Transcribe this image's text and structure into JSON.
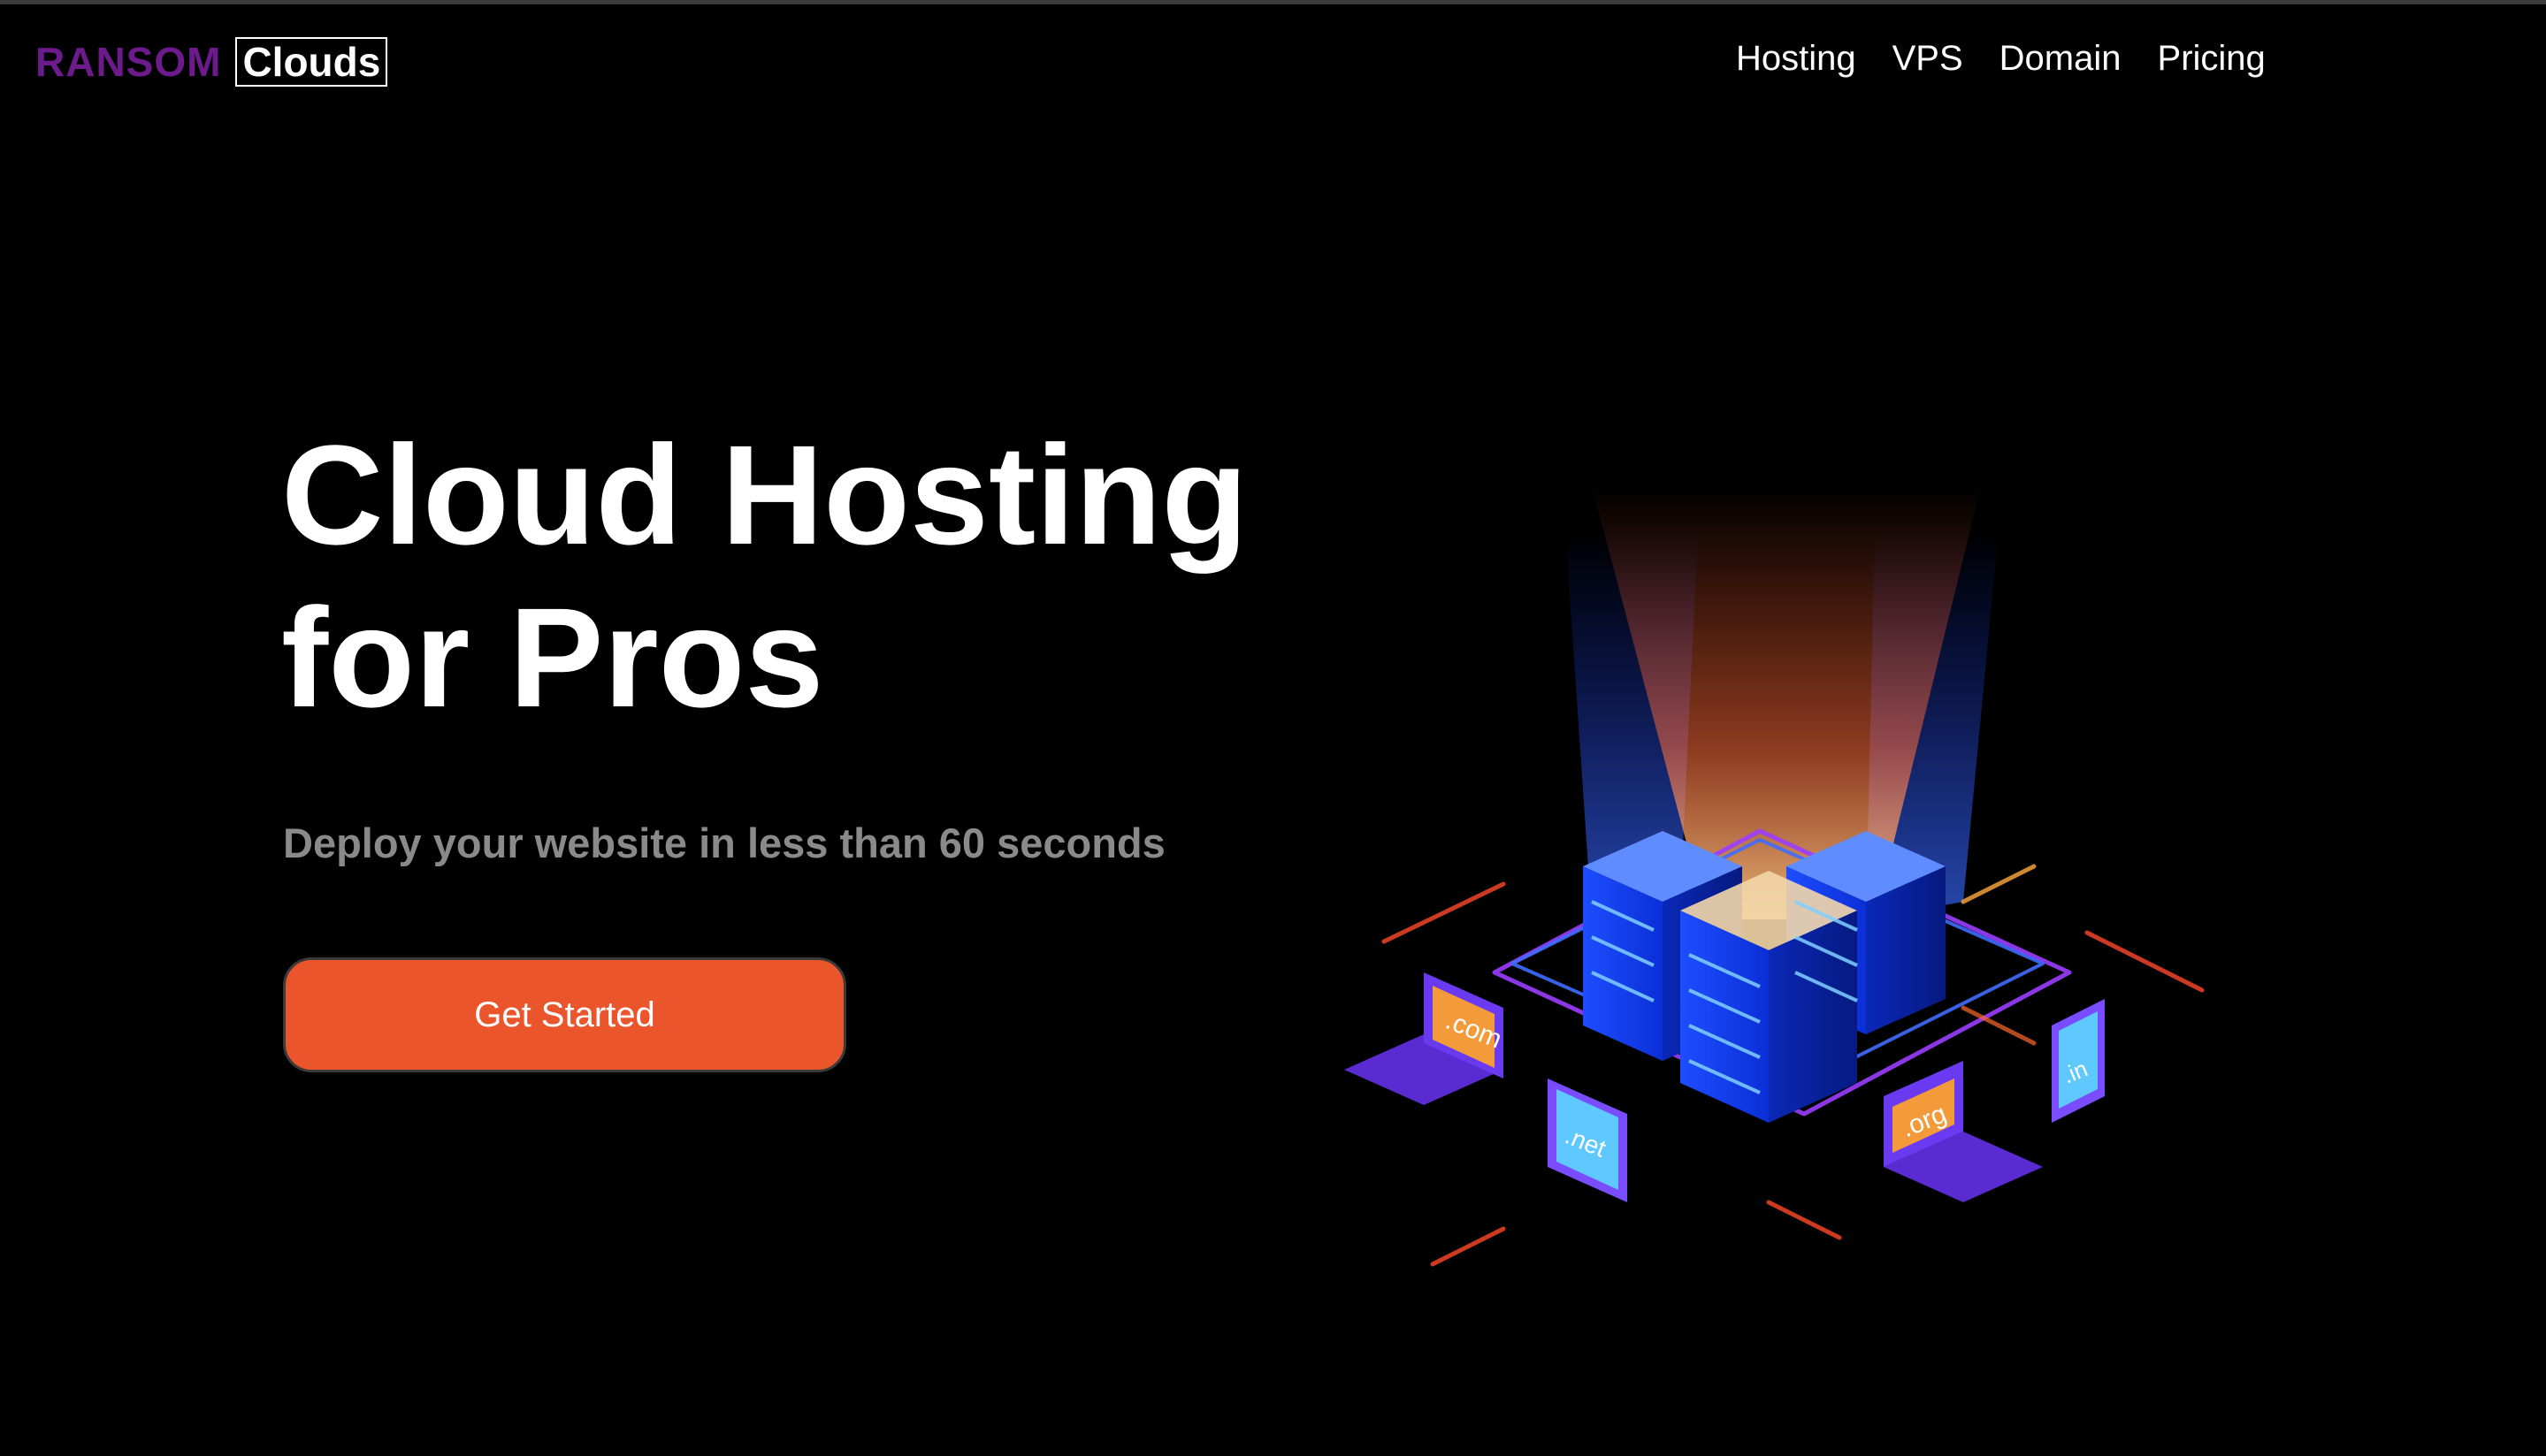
{
  "brand": {
    "part1": "RANSOM",
    "part2": "Clouds"
  },
  "nav": {
    "items": [
      "Hosting",
      "VPS",
      "Domain",
      "Pricing"
    ]
  },
  "hero": {
    "title_line1": "Cloud Hosting",
    "title_line2": "for Pros",
    "subtitle": "Deploy your website in less than 60 seconds",
    "cta_label": "Get Started"
  },
  "illustration": {
    "labels": [
      ".com",
      ".net",
      ".org",
      ".in"
    ]
  },
  "colors": {
    "background": "#000000",
    "brand_purple": "#6d1a8c",
    "accent_orange": "#ea552b",
    "subtitle_gray": "#8a8a8a"
  }
}
